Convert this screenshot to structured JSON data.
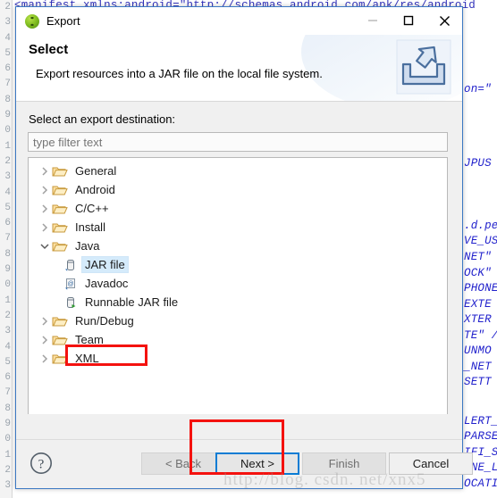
{
  "editor": {
    "gutter_digits": [
      "2",
      "3",
      "4",
      "5",
      "6",
      "7",
      "8",
      "9",
      "0",
      "1",
      "2",
      "3",
      "4",
      "5",
      "6",
      "7",
      "8",
      "9",
      "0",
      "1",
      "2",
      "3",
      "4",
      "5",
      "6",
      "7",
      "8",
      "9",
      "0",
      "1",
      "2",
      "3"
    ],
    "top_code_line": "<manifest xmlns:android=\"http://schemas.android.com/apk/res/android",
    "right_code_fragments": [
      "on=\"",
      "JPUS",
      ".d.pe",
      "VE_US",
      "NET\"",
      "OCK\"",
      "PHONE",
      "EXTE",
      "XTER",
      "TE\" /",
      "UNMO",
      "_NET",
      "SETT",
      "LERT_",
      "PARSE",
      "IFI_S",
      "INE_L",
      "OCATI"
    ],
    "watermark": "http://blog. csdn. net/xnx5"
  },
  "dialog": {
    "title": "Export",
    "app_icon": "eclipse-icon",
    "window_controls": {
      "minimize": "minimize-icon",
      "maximize": "maximize-icon",
      "close": "close-icon"
    },
    "header": {
      "title": "Select",
      "description": "Export resources into a JAR file on the local file system.",
      "icon": "export-banner-icon"
    },
    "destination_label": "Select an export destination:",
    "filter": {
      "value": "",
      "placeholder": "type filter text"
    },
    "tree": [
      {
        "label": "General",
        "type": "folder",
        "expanded": false,
        "depth": 0,
        "selected": false,
        "icon": "folder-icon"
      },
      {
        "label": "Android",
        "type": "folder",
        "expanded": false,
        "depth": 0,
        "selected": false,
        "icon": "folder-icon"
      },
      {
        "label": "C/C++",
        "type": "folder",
        "expanded": false,
        "depth": 0,
        "selected": false,
        "icon": "folder-icon"
      },
      {
        "label": "Install",
        "type": "folder",
        "expanded": false,
        "depth": 0,
        "selected": false,
        "icon": "folder-icon"
      },
      {
        "label": "Java",
        "type": "folder",
        "expanded": true,
        "depth": 0,
        "selected": false,
        "icon": "folder-open-icon"
      },
      {
        "label": "JAR file",
        "type": "leaf",
        "expanded": false,
        "depth": 1,
        "selected": true,
        "icon": "jar-file-icon"
      },
      {
        "label": "Javadoc",
        "type": "leaf",
        "expanded": false,
        "depth": 1,
        "selected": false,
        "icon": "javadoc-icon"
      },
      {
        "label": "Runnable JAR file",
        "type": "leaf",
        "expanded": false,
        "depth": 1,
        "selected": false,
        "icon": "runnable-jar-icon"
      },
      {
        "label": "Run/Debug",
        "type": "folder",
        "expanded": false,
        "depth": 0,
        "selected": false,
        "icon": "folder-icon"
      },
      {
        "label": "Team",
        "type": "folder",
        "expanded": false,
        "depth": 0,
        "selected": false,
        "icon": "folder-icon"
      },
      {
        "label": "XML",
        "type": "folder",
        "expanded": false,
        "depth": 0,
        "selected": false,
        "icon": "folder-icon"
      }
    ],
    "footer": {
      "help": "help-icon",
      "buttons": [
        {
          "label": "< Back",
          "enabled": false,
          "focused": false,
          "name": "back-button"
        },
        {
          "label": "Next >",
          "enabled": true,
          "focused": true,
          "name": "next-button"
        },
        {
          "label": "Finish",
          "enabled": false,
          "focused": false,
          "name": "finish-button"
        },
        {
          "label": "Cancel",
          "enabled": true,
          "focused": false,
          "name": "cancel-button"
        }
      ]
    }
  },
  "annotations": {
    "jar_file_highlight_color": "#f4120f",
    "next_button_highlight_color": "#f4120f",
    "focus_border_color": "#0a7cd4",
    "selection_color": "#d5ebfb"
  }
}
